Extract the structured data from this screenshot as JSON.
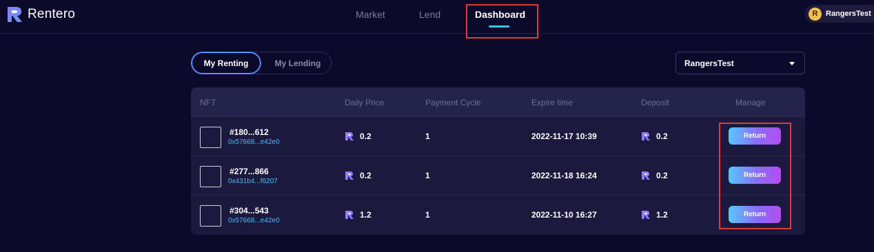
{
  "app": {
    "name": "Rentero"
  },
  "nav": {
    "items": [
      {
        "label": "Market"
      },
      {
        "label": "Lend"
      },
      {
        "label": "Dashboard",
        "active": true
      }
    ]
  },
  "user": {
    "coin_letter": "R",
    "name": "RangersTest"
  },
  "tabs": [
    {
      "label": "My Renting",
      "active": true
    },
    {
      "label": "My Lending",
      "active": false
    }
  ],
  "account_select": {
    "value": "RangersTest"
  },
  "table": {
    "headers": {
      "nft": "NFT",
      "price": "Daily Price",
      "cycle": "Payment Cycle",
      "expire": "Expire time",
      "deposit": "Deposit",
      "manage": "Manage"
    },
    "rows": [
      {
        "id": "#180...612",
        "addr": "0x57668...e42e0",
        "price": "0.2",
        "cycle": "1",
        "expire": "2022-11-17 10:39",
        "deposit": "0.2",
        "action": "Return"
      },
      {
        "id": "#277...866",
        "addr": "0x431b4...f6207",
        "price": "0.2",
        "cycle": "1",
        "expire": "2022-11-18 16:24",
        "deposit": "0.2",
        "action": "Return"
      },
      {
        "id": "#304...543",
        "addr": "0x57668...e42e0",
        "price": "1.2",
        "cycle": "1",
        "expire": "2022-11-10 16:27",
        "deposit": "1.2",
        "action": "Return"
      }
    ]
  },
  "colors": {
    "background": "#0b0a2a",
    "accent_blue": "#3ec1ff",
    "accent_purple": "#b44df0",
    "highlight_red": "#e23a3a"
  },
  "icons": {
    "logo": "rentero-logo-icon",
    "token": "rentero-token-icon",
    "caret": "caret-down-icon"
  }
}
